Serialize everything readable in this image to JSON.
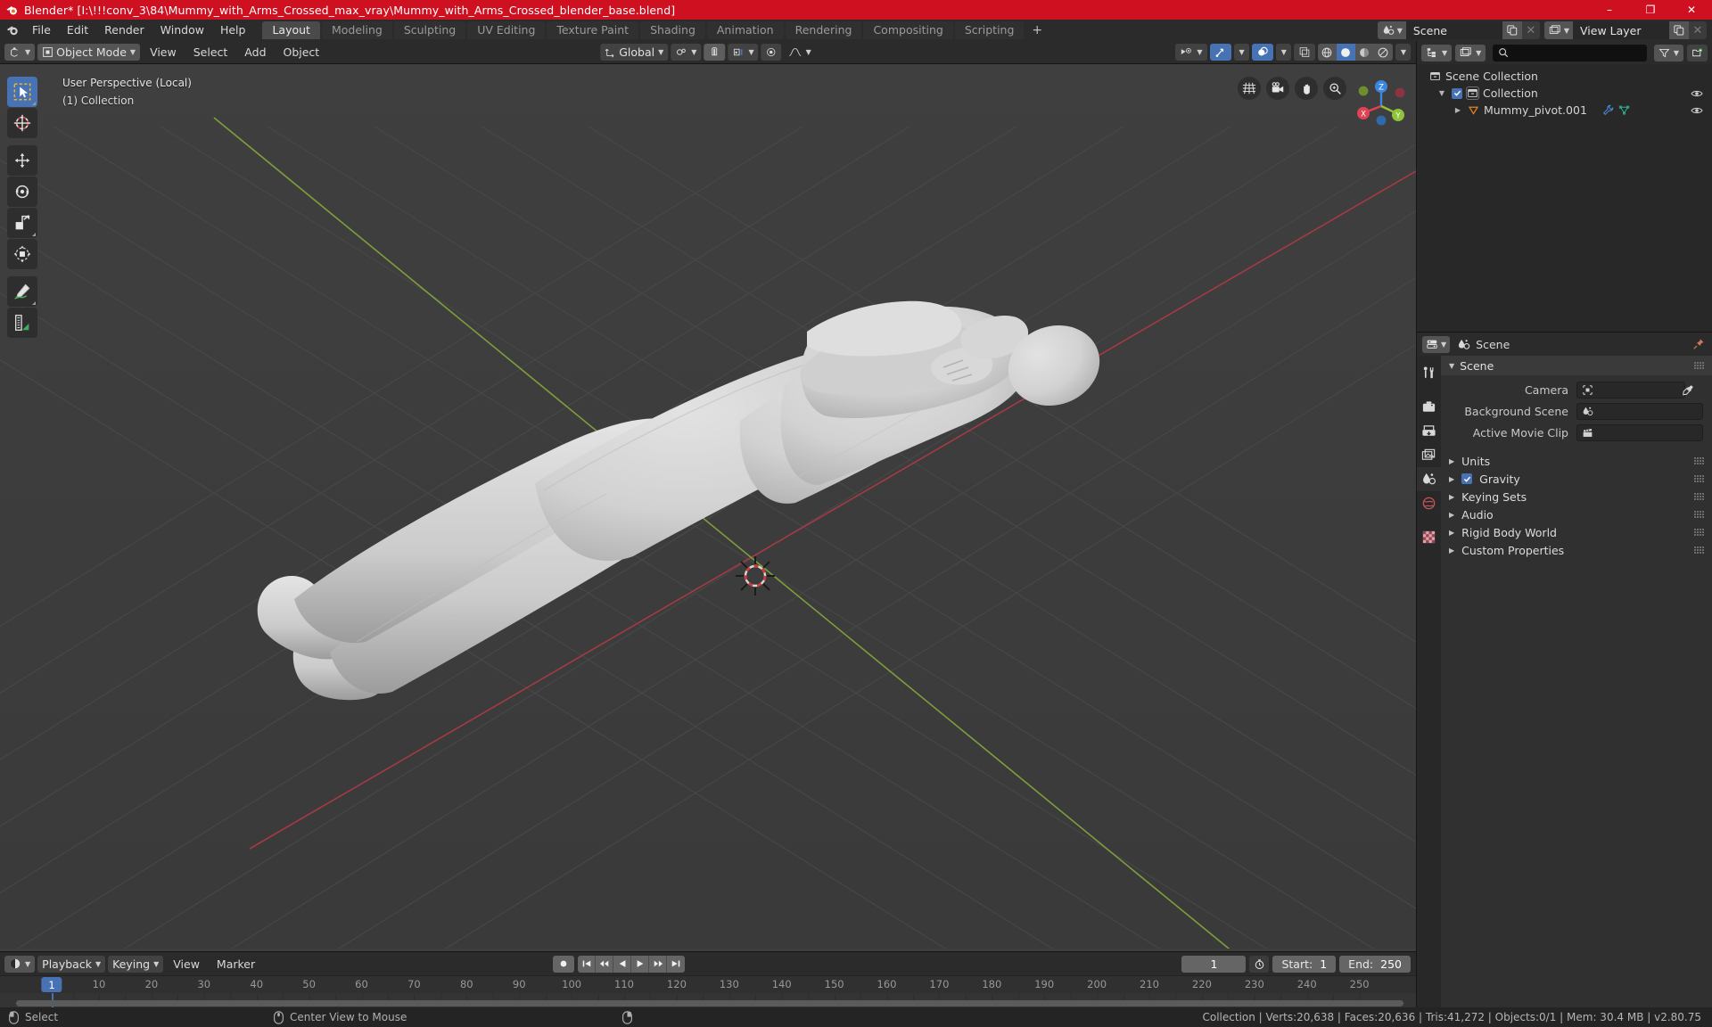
{
  "titlebar": {
    "text": "Blender* [I:\\!!!conv_3\\84\\Mummy_with_Arms_Crossed_max_vray\\Mummy_with_Arms_Crossed_blender_base.blend]",
    "minimize": "–",
    "maximize": "❐",
    "close": "✕",
    "accent_color": "#cf1020"
  },
  "topbar": {
    "menus": [
      "File",
      "Edit",
      "Render",
      "Window",
      "Help"
    ],
    "workspaces": [
      {
        "label": "Layout",
        "active": true
      },
      {
        "label": "Modeling",
        "active": false
      },
      {
        "label": "Sculpting",
        "active": false
      },
      {
        "label": "UV Editing",
        "active": false
      },
      {
        "label": "Texture Paint",
        "active": false
      },
      {
        "label": "Shading",
        "active": false
      },
      {
        "label": "Animation",
        "active": false
      },
      {
        "label": "Rendering",
        "active": false
      },
      {
        "label": "Compositing",
        "active": false
      },
      {
        "label": "Scripting",
        "active": false
      }
    ],
    "add_workspace": "+",
    "scene_name": "Scene",
    "view_layer_name": "View Layer"
  },
  "viewport_header": {
    "mode": "Object Mode",
    "menus": [
      "View",
      "Select",
      "Add",
      "Object"
    ],
    "transform_orientation": "Global",
    "snap_enabled": true,
    "proportional_edit": false
  },
  "viewport": {
    "overlay_line1": "User Perspective (Local)",
    "overlay_line2": "(1) Collection",
    "gizmo_axes": [
      "X",
      "Y",
      "Z"
    ],
    "background_color": "#3d3d3d",
    "object_color": "#d4d4d4"
  },
  "toolbar": {
    "tools": [
      {
        "name": "select-box-tool",
        "active": true
      },
      {
        "name": "cursor-tool",
        "active": false
      },
      {
        "name": "move-tool",
        "active": false
      },
      {
        "name": "rotate-tool",
        "active": false
      },
      {
        "name": "scale-tool",
        "active": false
      },
      {
        "name": "transform-tool",
        "active": false
      },
      {
        "name": "annotate-tool",
        "active": false
      },
      {
        "name": "measure-tool",
        "active": false
      }
    ]
  },
  "nav_icons": [
    "grid-icon",
    "camera-icon",
    "hand-icon",
    "zoom-icon"
  ],
  "outliner": {
    "display_mode": "view-layer",
    "search_placeholder": "",
    "rows": [
      {
        "label": "Scene Collection",
        "indent": 0,
        "icon": "collection-icon",
        "has_disclosure": false,
        "has_checkbox": false,
        "eye": false
      },
      {
        "label": "Collection",
        "indent": 1,
        "icon": "collection-icon",
        "has_disclosure": true,
        "has_checkbox": true,
        "eye": true
      },
      {
        "label": "Mummy_pivot.001",
        "indent": 2,
        "icon": "empty-icon",
        "has_disclosure": true,
        "has_checkbox": false,
        "eye": true,
        "extra_icons": [
          "wrench-icon",
          "mesh-data-icon"
        ]
      }
    ]
  },
  "properties": {
    "breadcrumb": "Scene",
    "tabs": [
      "tool-icon",
      "render-icon",
      "output-icon",
      "view-layer-icon",
      "scene-icon",
      "world-icon",
      "texture-icon"
    ],
    "active_tab_index": 4,
    "panel_title": "Scene",
    "fields": [
      {
        "label": "Camera",
        "value": "",
        "icon": "camera-data-icon",
        "eyedropper": true
      },
      {
        "label": "Background Scene",
        "value": "",
        "icon": "scene-icon",
        "eyedropper": false
      },
      {
        "label": "Active Movie Clip",
        "value": "",
        "icon": "clip-icon",
        "eyedropper": false
      }
    ],
    "sections": [
      {
        "label": "Units",
        "checkbox": false
      },
      {
        "label": "Gravity",
        "checkbox": true,
        "checked": true
      },
      {
        "label": "Keying Sets",
        "checkbox": false
      },
      {
        "label": "Audio",
        "checkbox": false
      },
      {
        "label": "Rigid Body World",
        "checkbox": false
      },
      {
        "label": "Custom Properties",
        "checkbox": false
      }
    ]
  },
  "timeline": {
    "menus": [
      "Playback",
      "Keying",
      "View",
      "Marker"
    ],
    "current_frame": "1",
    "start_label": "Start:",
    "start_value": "1",
    "end_label": "End:",
    "end_value": "250",
    "ticks": [
      10,
      20,
      30,
      40,
      50,
      60,
      70,
      80,
      90,
      100,
      110,
      120,
      130,
      140,
      150,
      160,
      170,
      180,
      190,
      200,
      210,
      220,
      230,
      240,
      250
    ],
    "playhead_frame": "1"
  },
  "statusbar": {
    "items": [
      {
        "icon": "mouse-left-icon",
        "label": "Select"
      },
      {
        "icon": "mouse-middle-icon",
        "label": "Center View to Mouse"
      },
      {
        "icon": "mouse-right-icon",
        "label": ""
      }
    ],
    "stats": "Collection | Verts:20,638 | Faces:20,636 | Tris:41,272 | Objects:0/1 | Mem: 30.4 MB | v2.80.75"
  }
}
